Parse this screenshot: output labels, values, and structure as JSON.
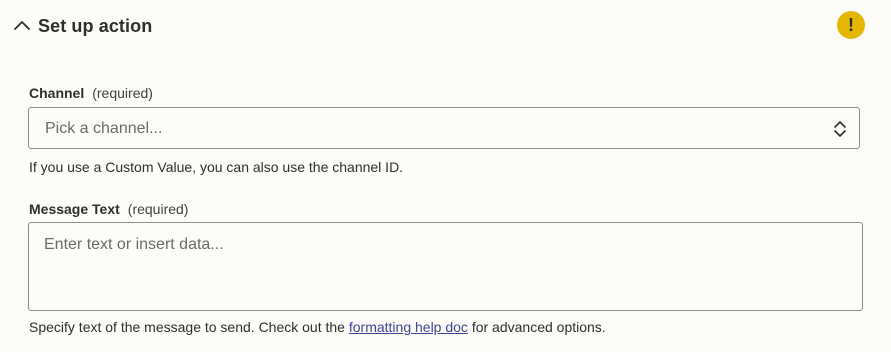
{
  "section": {
    "title": "Set up action",
    "warning_symbol": "!",
    "expanded": true
  },
  "channel": {
    "label": "Channel",
    "required_text": "(required)",
    "placeholder": "Pick a channel...",
    "help": "If you use a Custom Value, you can also use the channel ID."
  },
  "message": {
    "label": "Message Text",
    "required_text": "(required)",
    "placeholder": "Enter text or insert data...",
    "help_before": "Specify text of the message to send. Check out the ",
    "help_link": "formatting help doc",
    "help_after": " for advanced options."
  },
  "colors": {
    "background": "#fdfcf8",
    "warning": "#e5b600",
    "link": "#3d4592",
    "border": "#8c8c8c"
  },
  "icons": {
    "collapse": "chevron-up-icon",
    "warning": "warning-icon",
    "select": "updown-chevron-icon"
  }
}
